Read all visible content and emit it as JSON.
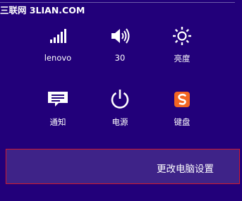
{
  "watermark": {
    "text": "三联网 3LIAN.COM"
  },
  "settings_tiles": [
    {
      "label": "lenovo",
      "icon": "wifi-signal-icon"
    },
    {
      "label": "30",
      "icon": "volume-icon"
    },
    {
      "label": "亮度",
      "icon": "brightness-icon"
    },
    {
      "label": "通知",
      "icon": "notifications-icon"
    },
    {
      "label": "电源",
      "icon": "power-icon"
    },
    {
      "label": "键盘",
      "icon": "sogou-keyboard-icon"
    }
  ],
  "pc_settings": {
    "label": "更改电脑设置"
  },
  "colors": {
    "background": "#22007a",
    "highlight": "#3e2388",
    "highlight_border": "#d01a2e",
    "keyboard_icon": "#f26522"
  }
}
